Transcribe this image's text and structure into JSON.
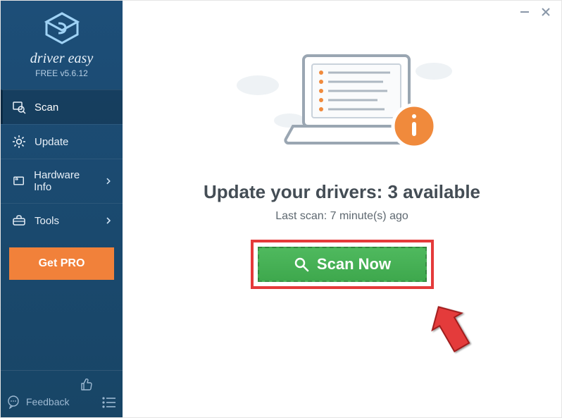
{
  "brand": {
    "name": "driver easy",
    "version": "FREE v5.6.12"
  },
  "sidebar": {
    "items": [
      {
        "label": "Scan"
      },
      {
        "label": "Update"
      },
      {
        "label": "Hardware Info"
      },
      {
        "label": "Tools"
      }
    ],
    "get_pro": "Get PRO",
    "feedback": "Feedback"
  },
  "main": {
    "heading": "Update your drivers: 3 available",
    "subheading": "Last scan: 7 minute(s) ago",
    "scan_button": "Scan Now"
  }
}
